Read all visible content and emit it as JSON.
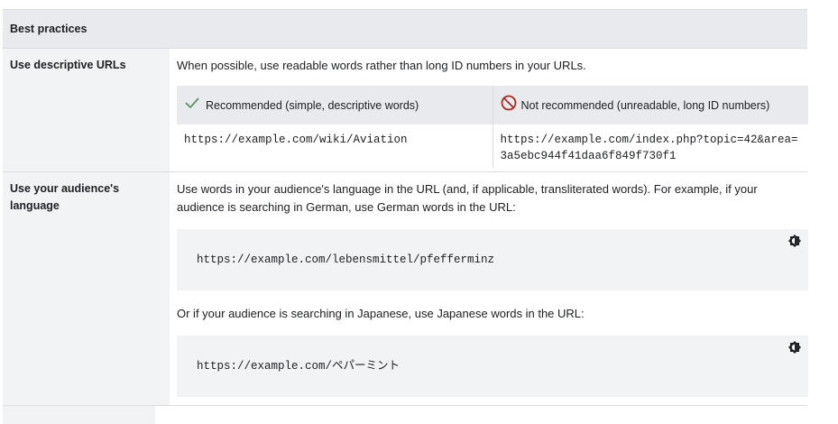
{
  "header": {
    "title": "Best practices"
  },
  "rows": [
    {
      "label": "Use descriptive URLs",
      "text": "When possible, use readable words rather than long ID numbers in your URLs.",
      "table": {
        "recommended_header": "Recommended (simple, descriptive words)",
        "not_recommended_header": "Not recommended (unreadable, long ID numbers)",
        "recommended_value": "https://example.com/wiki/Aviation",
        "not_recommended_value": "https://example.com/index.php?topic=42&area=3a5ebc944f41daa6f849f730f1"
      }
    },
    {
      "label": "Use your audience's language",
      "text": "Use words in your audience's language in the URL (and, if applicable, transliterated words). For example, if your audience is searching in German, use German words in the URL:",
      "code1": "https://example.com/lebensmittel/pfefferminz",
      "text2": "Or if your audience is searching in Japanese, use Japanese words in the URL:",
      "code2": "https://example.com/ペパーミント"
    }
  ],
  "colors": {
    "check": "#1e8e3e",
    "prohibit": "#b3261e"
  }
}
